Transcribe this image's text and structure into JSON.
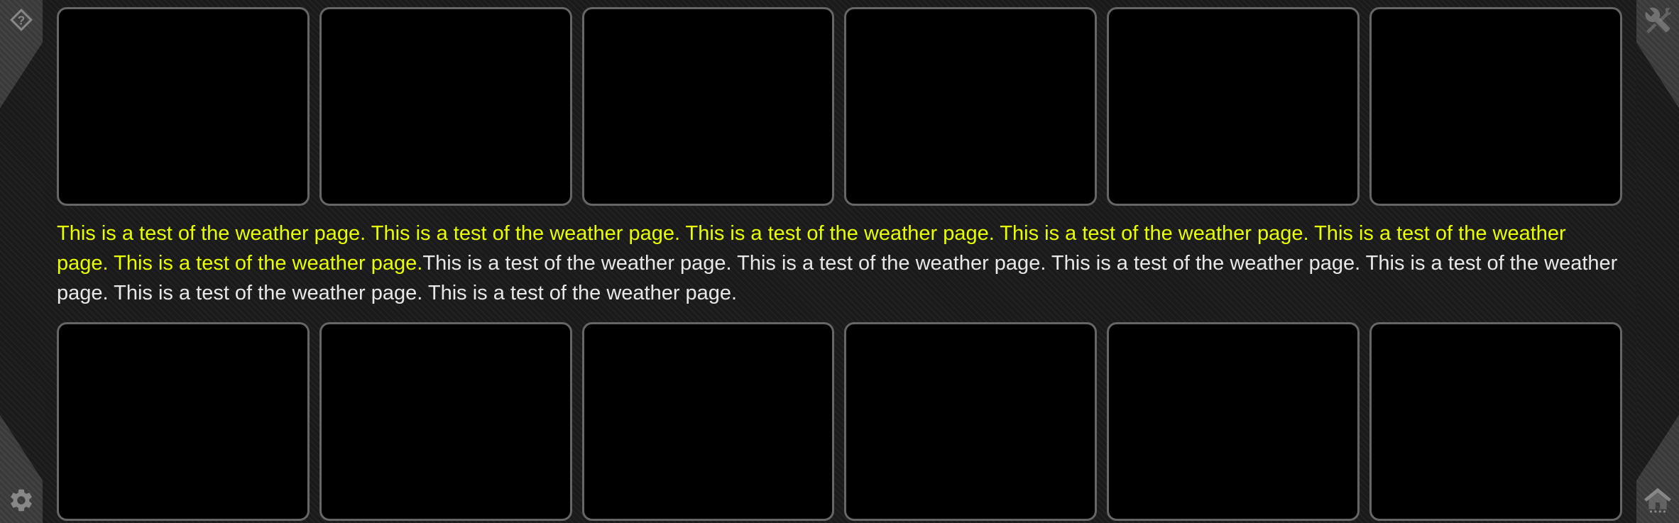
{
  "icons": {
    "help": "help-icon",
    "tools": "tools-icon",
    "settings": "gear-icon",
    "home": "home-icon"
  },
  "text": {
    "yellow": "This is a test of the weather page. This is a test of the weather page. This is a test of the weather page. This is a test of the weather page. This is a test of the weather page. This is a test of the weather page.",
    "white": "This is a test of the weather page. This is a test of the weather page. This is a test of the weather page. This is a test of the weather page. This is a test of the weather page. This is a test of the weather page."
  },
  "cards": {
    "top_count": 6,
    "bottom_count": 6
  }
}
